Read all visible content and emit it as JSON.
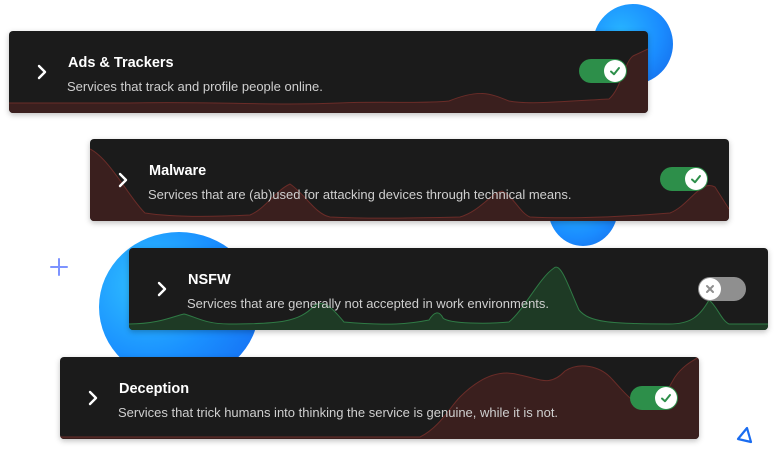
{
  "categories": [
    {
      "title": "Ads & Trackers",
      "description": "Services that track and profile people online.",
      "enabled": true
    },
    {
      "title": "Malware",
      "description": "Services that are (ab)used for attacking devices through technical means.",
      "enabled": true
    },
    {
      "title": "NSFW",
      "description": "Services that are generally not accepted in work environments.",
      "enabled": false
    },
    {
      "title": "Deception",
      "description": "Services that trick humans into thinking the service is genuine, while it is not.",
      "enabled": true
    }
  ],
  "colors": {
    "card_bg": "#1b1b1b",
    "toggle_on": "#2d8f4a",
    "toggle_off": "#8f8f8f",
    "accent_blue": "#1a8cff",
    "wave_red": "#3a1f1e",
    "wave_green": "#1e3a25"
  },
  "icons": {
    "expand": "chevron-right-icon",
    "on": "check-icon",
    "off": "x-icon",
    "decor_plus": "plus-icon",
    "decor_triangle": "triangle-icon"
  }
}
